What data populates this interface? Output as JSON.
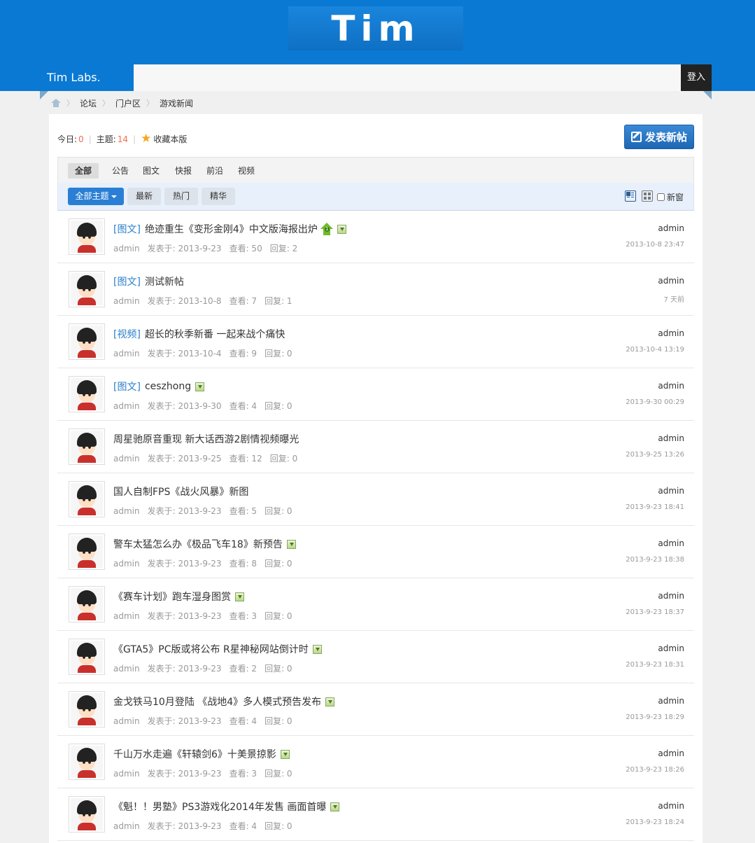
{
  "header": {
    "logo_text": "Tim"
  },
  "navbar": {
    "brand": "Tim Labs.",
    "search_value": "",
    "login_label": "登入"
  },
  "breadcrumb": [
    "论坛",
    "门户区",
    "游戏新闻"
  ],
  "forum_stats": {
    "today_label": "今日:",
    "today_value": "0",
    "topics_label": "主题:",
    "topics_value": "14",
    "favorite_label": "收藏本版"
  },
  "post_button_label": "发表新帖",
  "type_tabs": [
    "全部",
    "公告",
    "图文",
    "快报",
    "前沿",
    "视频"
  ],
  "filter_tabs": {
    "all_topics": "全部主题",
    "latest": "最新",
    "hot": "热门",
    "digest": "精华"
  },
  "new_window_label": "新窗",
  "threads": [
    {
      "tag": "[图文]",
      "title": "绝迹重生《变形金刚4》中文版海报出炉",
      "has_image": true,
      "up_badge": "1",
      "author": "admin",
      "posted": "发表于: 2013-9-23",
      "views": "查看: 50",
      "replies": "回复: 2",
      "last_user": "admin",
      "last_time": "2013-10-8 23:47"
    },
    {
      "tag": "[图文]",
      "title": "测试新帖",
      "has_image": false,
      "author": "admin",
      "posted": "发表于: 2013-10-8",
      "views": "查看: 7",
      "replies": "回复: 1",
      "last_user": "admin",
      "last_time": "7 天前"
    },
    {
      "tag": "[视频]",
      "title": "超长的秋季新番 一起来战个痛快",
      "has_image": false,
      "author": "admin",
      "posted": "发表于: 2013-10-4",
      "views": "查看: 9",
      "replies": "回复: 0",
      "last_user": "admin",
      "last_time": "2013-10-4 13:19"
    },
    {
      "tag": "[图文]",
      "title": "ceszhong",
      "has_image": true,
      "author": "admin",
      "posted": "发表于: 2013-9-30",
      "views": "查看: 4",
      "replies": "回复: 0",
      "last_user": "admin",
      "last_time": "2013-9-30 00:29"
    },
    {
      "tag": "",
      "title": "周星驰原音重现 新大话西游2剧情视频曝光",
      "has_image": false,
      "author": "admin",
      "posted": "发表于: 2013-9-25",
      "views": "查看: 12",
      "replies": "回复: 0",
      "last_user": "admin",
      "last_time": "2013-9-25 13:26"
    },
    {
      "tag": "",
      "title": "国人自制FPS《战火风暴》新图",
      "has_image": false,
      "author": "admin",
      "posted": "发表于: 2013-9-23",
      "views": "查看: 5",
      "replies": "回复: 0",
      "last_user": "admin",
      "last_time": "2013-9-23 18:41"
    },
    {
      "tag": "",
      "title": "警车太猛怎么办《极品飞车18》新预告",
      "has_image": true,
      "author": "admin",
      "posted": "发表于: 2013-9-23",
      "views": "查看: 8",
      "replies": "回复: 0",
      "last_user": "admin",
      "last_time": "2013-9-23 18:38"
    },
    {
      "tag": "",
      "title": "《赛车计划》跑车湿身图赏",
      "has_image": true,
      "author": "admin",
      "posted": "发表于: 2013-9-23",
      "views": "查看: 3",
      "replies": "回复: 0",
      "last_user": "admin",
      "last_time": "2013-9-23 18:37"
    },
    {
      "tag": "",
      "title": "《GTA5》PC版或将公布 R星神秘网站倒计时",
      "has_image": true,
      "author": "admin",
      "posted": "发表于: 2013-9-23",
      "views": "查看: 2",
      "replies": "回复: 0",
      "last_user": "admin",
      "last_time": "2013-9-23 18:31"
    },
    {
      "tag": "",
      "title": "金戈铁马10月登陆 《战地4》多人模式预告发布",
      "has_image": true,
      "author": "admin",
      "posted": "发表于: 2013-9-23",
      "views": "查看: 4",
      "replies": "回复: 0",
      "last_user": "admin",
      "last_time": "2013-9-23 18:29"
    },
    {
      "tag": "",
      "title": "千山万水走遍《轩辕剑6》十美景掠影",
      "has_image": true,
      "author": "admin",
      "posted": "发表于: 2013-9-23",
      "views": "查看: 3",
      "replies": "回复: 0",
      "last_user": "admin",
      "last_time": "2013-9-23 18:26"
    },
    {
      "tag": "",
      "title": "《魁！！男塾》PS3游戏化2014年发售 画面首曝",
      "has_image": true,
      "author": "admin",
      "posted": "发表于: 2013-9-23",
      "views": "查看: 4",
      "replies": "回复: 0",
      "last_user": "admin",
      "last_time": "2013-9-23 18:24"
    }
  ]
}
